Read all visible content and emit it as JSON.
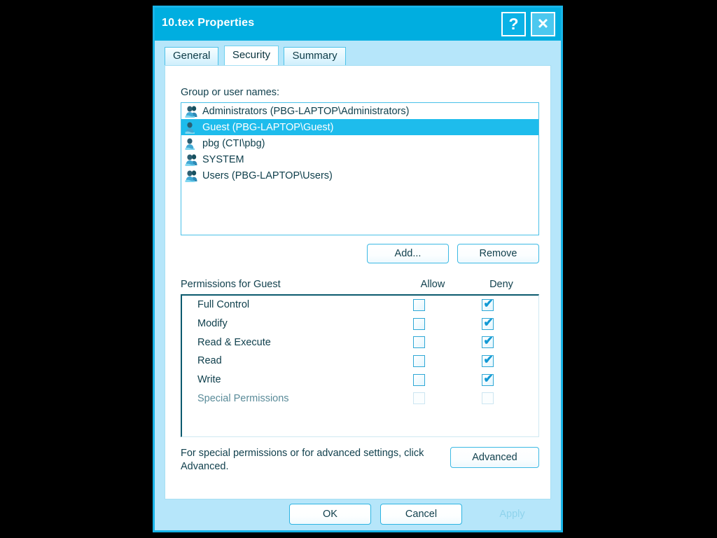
{
  "window": {
    "title": "10.tex Properties",
    "help_button": "?",
    "close_button": "×",
    "titlebar_color": "#00aee0",
    "frame_color": "#18b4e8",
    "body_color": "#b6e6fa"
  },
  "tabs": [
    {
      "label": "General",
      "active": false
    },
    {
      "label": "Security",
      "active": true
    },
    {
      "label": "Summary",
      "active": false
    }
  ],
  "security": {
    "group_label": "Group or user names:",
    "users": [
      {
        "name": "Administrators (PBG-LAPTOP\\Administrators)",
        "icon": "group-icon",
        "selected": false
      },
      {
        "name": "Guest (PBG-LAPTOP\\Guest)",
        "icon": "user-icon",
        "selected": true
      },
      {
        "name": "pbg (CTI\\pbg)",
        "icon": "user-icon",
        "selected": false
      },
      {
        "name": "SYSTEM",
        "icon": "group-icon",
        "selected": false
      },
      {
        "name": "Users (PBG-LAPTOP\\Users)",
        "icon": "group-icon",
        "selected": false
      }
    ],
    "add_label": "Add...",
    "remove_label": "Remove",
    "permissions_label": "Permissions for Guest",
    "allow_header": "Allow",
    "deny_header": "Deny",
    "permissions": [
      {
        "name": "Full Control",
        "allow": false,
        "deny": true,
        "disabled": false
      },
      {
        "name": "Modify",
        "allow": false,
        "deny": true,
        "disabled": false
      },
      {
        "name": "Read & Execute",
        "allow": false,
        "deny": true,
        "disabled": false
      },
      {
        "name": "Read",
        "allow": false,
        "deny": true,
        "disabled": false
      },
      {
        "name": "Write",
        "allow": false,
        "deny": true,
        "disabled": false
      },
      {
        "name": "Special Permissions",
        "allow": false,
        "deny": false,
        "disabled": true
      }
    ],
    "checkmark": "✔",
    "advanced_note": "For special permissions or for advanced settings, click Advanced.",
    "advanced_label": "Advanced",
    "selection_color": "#1ebcec"
  },
  "footer": {
    "ok_label": "OK",
    "cancel_label": "Cancel",
    "apply_label": "Apply",
    "apply_enabled": false
  }
}
